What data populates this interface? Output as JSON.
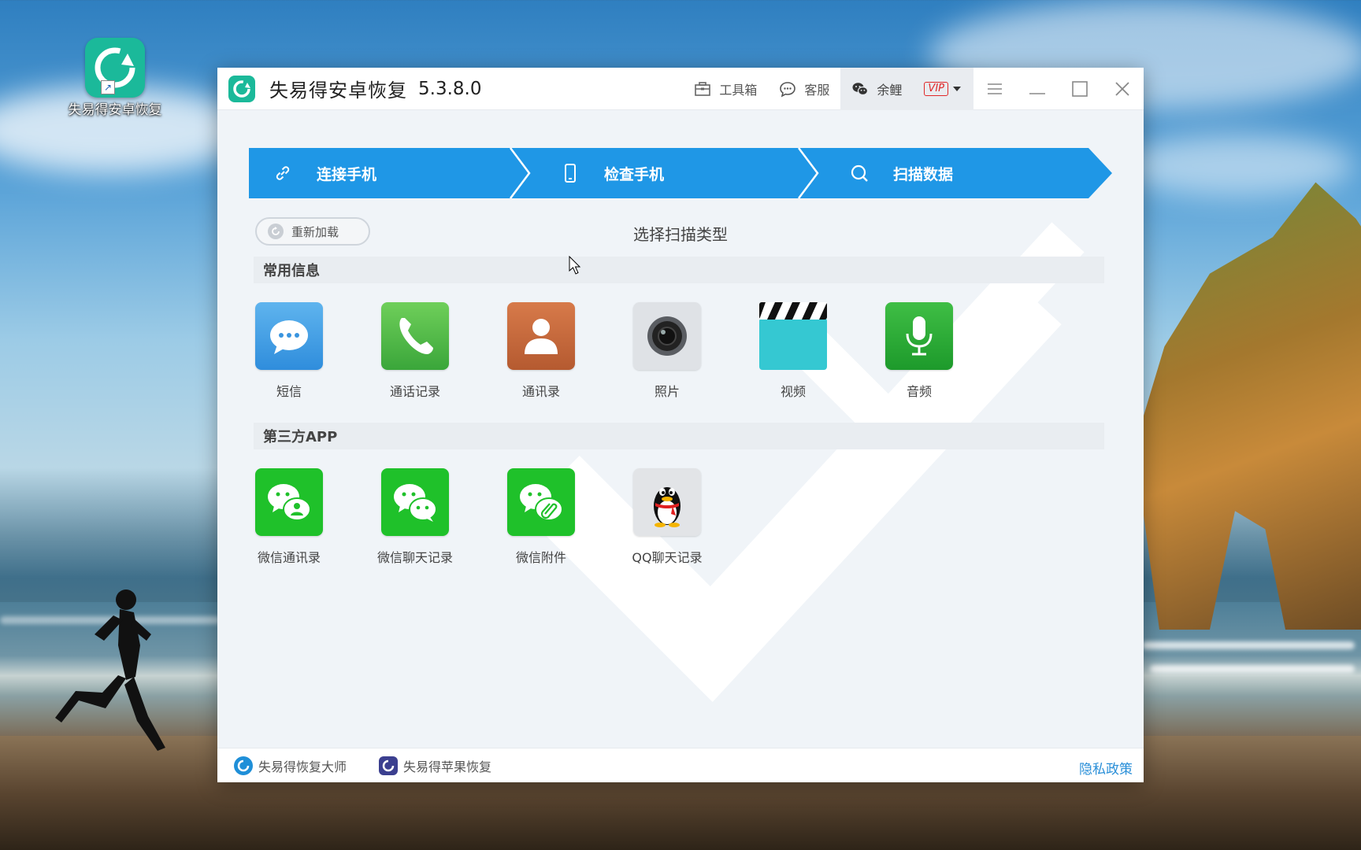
{
  "desktop": {
    "icon_label": "失易得安卓恢复"
  },
  "window": {
    "title": "失易得安卓恢复",
    "version": "5.3.8.0",
    "toolbar": {
      "toolbox_label": "工具箱",
      "service_label": "客服",
      "user_name": "余鲤",
      "vip_label": "VIP"
    }
  },
  "steps": [
    {
      "label": "连接手机",
      "done": true
    },
    {
      "label": "检查手机",
      "done": true
    },
    {
      "label": "扫描数据",
      "done": false
    }
  ],
  "reload_label": "重新加载",
  "scan_title": "选择扫描类型",
  "sections": {
    "common": {
      "title": "常用信息",
      "items": [
        {
          "label": "短信",
          "icon": "sms-icon"
        },
        {
          "label": "通话记录",
          "icon": "phone-icon"
        },
        {
          "label": "通讯录",
          "icon": "contacts-icon"
        },
        {
          "label": "照片",
          "icon": "camera-icon"
        },
        {
          "label": "视频",
          "icon": "clapperboard-icon"
        },
        {
          "label": "音频",
          "icon": "microphone-icon"
        }
      ]
    },
    "third_party": {
      "title": "第三方APP",
      "items": [
        {
          "label": "微信通讯录",
          "icon": "wechat-contacts-icon"
        },
        {
          "label": "微信聊天记录",
          "icon": "wechat-chat-icon"
        },
        {
          "label": "微信附件",
          "icon": "wechat-attachment-icon"
        },
        {
          "label": "QQ聊天记录",
          "icon": "qq-penguin-icon"
        }
      ]
    }
  },
  "footer": {
    "link1": "失易得恢复大师",
    "link2": "失易得苹果恢复",
    "privacy": "隐私政策"
  },
  "colors": {
    "step_blue": "#1f97e6",
    "wechat_green": "#1fc12a",
    "link_blue": "#2a8fd8"
  }
}
